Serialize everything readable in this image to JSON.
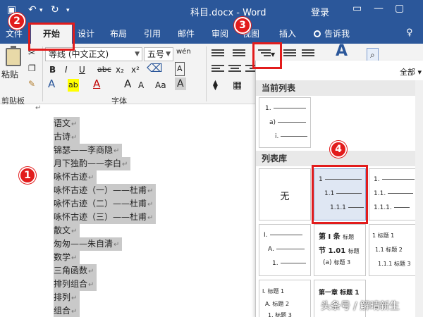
{
  "titlebar": {
    "title": "科目.docx - Word",
    "login": "登录",
    "save_icon": "save-icon",
    "undo_icon": "undo-icon",
    "redo_icon": "redo-icon"
  },
  "tabs": {
    "file": "文件",
    "home": "开始",
    "design": "设计",
    "layout": "布局",
    "references": "引用",
    "mailings": "邮件",
    "review": "审阅",
    "view": "视图",
    "insert": "插入",
    "tell_me": "告诉我"
  },
  "ribbon": {
    "paste_label": "粘贴",
    "clipboard_group": "剪贴板",
    "font_group": "字体",
    "font_name": "等线 (中文正文)",
    "font_size": "五号",
    "font_size_special": "wén",
    "bold": "B",
    "italic": "I",
    "underline": "U",
    "strikethrough": "abc",
    "subscript": "x₂",
    "superscript": "x²",
    "text_effect": "A",
    "highlight": "ab",
    "font_color": "A",
    "grow_font": "A",
    "shrink_font": "A",
    "change_case": "Aa",
    "char_shading": "A",
    "styles_icon": "A"
  },
  "document": {
    "lines": [
      "语文",
      "古诗",
      "锦瑟——李商隐",
      "月下独酌——李白",
      "咏怀古迹",
      "咏怀古迹（一）——杜甫",
      "咏怀古迹（二）——杜甫",
      "咏怀古迹（三）——杜甫",
      "散文",
      "匆匆——朱自清",
      "数学",
      "三角函数",
      "排列组合",
      "排列",
      "组合"
    ],
    "paragraph_mark": "↵"
  },
  "panel": {
    "filter": "全部",
    "current_list_header": "当前列表",
    "library_header": "列表库",
    "none_label": "无",
    "current_list": [
      "1.",
      "a)",
      "i."
    ],
    "tile_decimal": [
      "1",
      "1.1",
      "1.1.1"
    ],
    "tile_decimal_dot": [
      "1.",
      "1.1.",
      "1.1.1."
    ],
    "tile_roman": [
      "I.",
      "A.",
      "1."
    ],
    "tile_article": [
      "第 I 条",
      "标题",
      "节 1.01",
      "标题",
      "(a)",
      "标题 3"
    ],
    "tile_heading": [
      "1 标题 1",
      "1.1 标题 2",
      "1.1.1 标题 3"
    ],
    "tile_heading_roman": [
      "I. 标题 1",
      "A. 标题 2",
      "1. 标题 3"
    ],
    "tile_chapter": "第一章 标题 1"
  },
  "annotations": [
    "1",
    "2",
    "3",
    "4"
  ],
  "watermark": "头条号 / 解晴新生",
  "colors": {
    "ribbon_blue": "#2b579a",
    "annotation_red": "#e21c1c"
  }
}
